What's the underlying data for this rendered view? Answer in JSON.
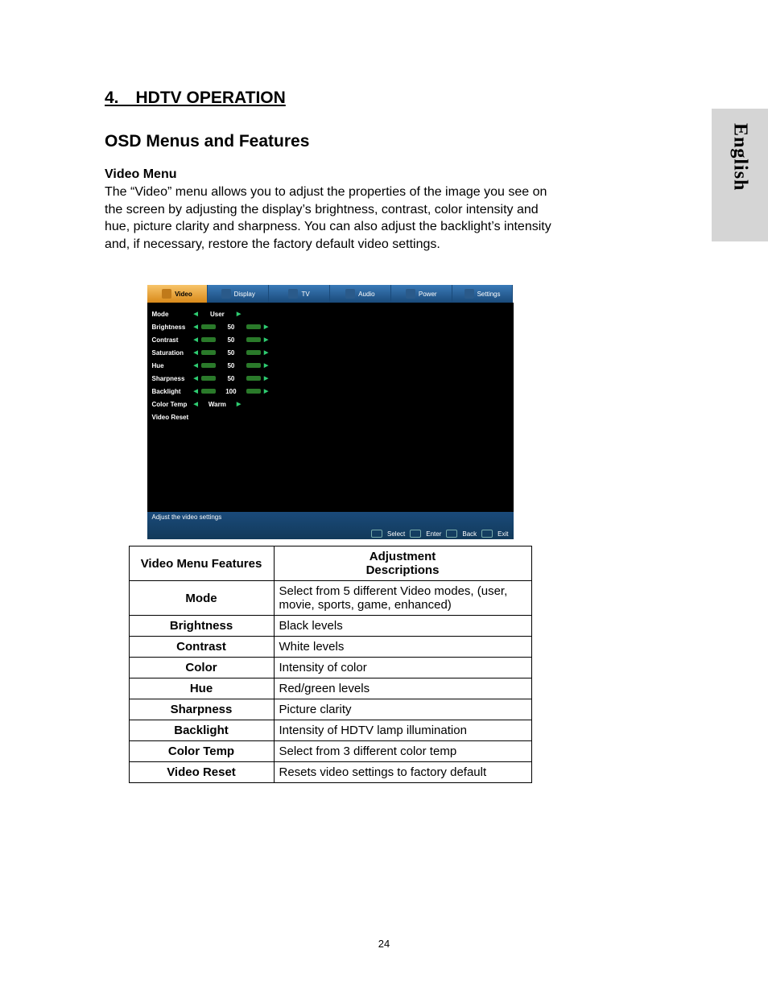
{
  "lang_tab": "English",
  "page_number": "24",
  "chapter": "4. HDTV OPERATION",
  "section": "OSD Menus and Features",
  "subhead": "Video Menu",
  "paragraph": "The “Video” menu allows you to adjust the properties of the image you see on the screen by adjusting the display’s brightness, contrast, color intensity and hue, picture clarity and sharpness. You can also adjust the backlight’s intensity and, if necessary, restore the factory default video settings.",
  "osd": {
    "tabs": [
      "Video",
      "Display",
      "TV",
      "Audio",
      "Power",
      "Settings"
    ],
    "rows": [
      {
        "label": "Mode",
        "type": "select",
        "value": "User"
      },
      {
        "label": "Brightness",
        "type": "slider",
        "value": "50"
      },
      {
        "label": "Contrast",
        "type": "slider",
        "value": "50"
      },
      {
        "label": "Saturation",
        "type": "slider",
        "value": "50"
      },
      {
        "label": "Hue",
        "type": "slider",
        "value": "50"
      },
      {
        "label": "Sharpness",
        "type": "slider",
        "value": "50"
      },
      {
        "label": "Backlight",
        "type": "slider",
        "value": "100"
      },
      {
        "label": "Color Temp",
        "type": "select",
        "value": "Warm"
      },
      {
        "label": "Video Reset",
        "type": "none",
        "value": ""
      }
    ],
    "hint_text": "Adjust the video settings",
    "hints": [
      "Select",
      "Enter",
      "Back",
      "Exit"
    ]
  },
  "table": {
    "head_left": "Video Menu Features",
    "head_right_1": "Adjustment",
    "head_right_2": "Descriptions",
    "rows": [
      {
        "f": "Mode",
        "d": "Select from  5 different Video modes, (user, movie, sports, game, enhanced)"
      },
      {
        "f": "Brightness",
        "d": "Black levels"
      },
      {
        "f": "Contrast",
        "d": "White levels"
      },
      {
        "f": "Color",
        "d": "Intensity of color"
      },
      {
        "f": "Hue",
        "d": "Red/green levels"
      },
      {
        "f": "Sharpness",
        "d": "Picture clarity"
      },
      {
        "f": "Backlight",
        "d": "Intensity of HDTV lamp illumination"
      },
      {
        "f": "Color Temp",
        "d": "Select from 3 different color temp"
      },
      {
        "f": "Video Reset",
        "d": "Resets video settings to factory default"
      }
    ]
  }
}
